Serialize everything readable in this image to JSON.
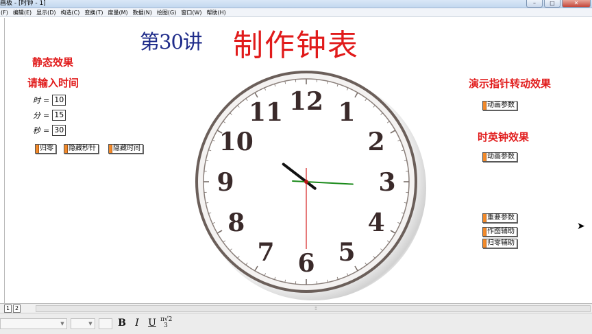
{
  "window": {
    "title": "画板 - [时钟 - 1]",
    "controls": [
      "–",
      "□",
      "✕"
    ]
  },
  "menu": [
    "(F)",
    "编辑(E)",
    "显示(D)",
    "构造(C)",
    "变换(T)",
    "度量(M)",
    "数据(N)",
    "绘图(G)",
    "窗口(W)",
    "帮助(H)"
  ],
  "canvas": {
    "lecture": "第30讲",
    "title": "制作钟表",
    "static_heading": "静态效果",
    "input_heading": "请输入时间",
    "params": [
      {
        "label": "时",
        "eq": "=",
        "value": "10"
      },
      {
        "label": "分",
        "eq": "=",
        "value": "15"
      },
      {
        "label": "秒",
        "eq": "=",
        "value": "30"
      }
    ],
    "buttons_left": [
      "归零",
      "隐藏秒针",
      "隐藏时间"
    ],
    "demo_heading": "演示指针转动效果",
    "demo_button": "动画参数",
    "chime_heading": "时英钟效果",
    "chime_button": "动画参数",
    "buttons_right": [
      "重要参数",
      "作图辅助",
      "归零辅助"
    ]
  },
  "clock": {
    "numerals": [
      "12",
      "1",
      "2",
      "3",
      "4",
      "5",
      "6",
      "7",
      "8",
      "9",
      "10",
      "11"
    ],
    "hour": 10,
    "minute": 15,
    "second": 30,
    "colors": {
      "hour_hand": "#111111",
      "minute_hand": "#1a8a1a",
      "second_hand": "#d42020",
      "numerals": "#3a2a2a",
      "rim": "#6b5f5a"
    }
  },
  "bottom": {
    "page_tabs": [
      "1",
      "2"
    ],
    "format_buttons": [
      "B",
      "I",
      "U"
    ]
  }
}
